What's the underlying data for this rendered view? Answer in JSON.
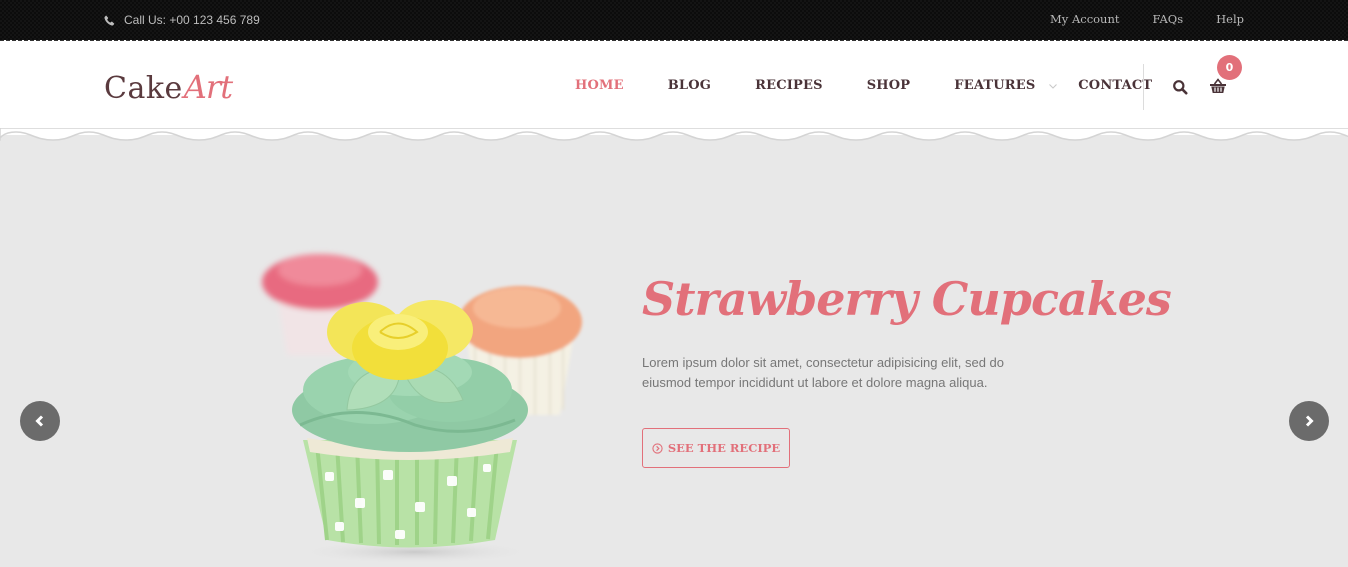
{
  "topbar": {
    "phone_icon": "phone-icon",
    "phone_text": "Call Us: +00 123 456 789",
    "links": [
      "My Account",
      "FAQs",
      "Help"
    ]
  },
  "header": {
    "logo": {
      "part1": "Cake",
      "part2": "Art"
    },
    "nav": [
      {
        "label": "HOME",
        "active": true
      },
      {
        "label": "BLOG",
        "active": false
      },
      {
        "label": "RECIPES",
        "active": false
      },
      {
        "label": "SHOP",
        "active": false
      },
      {
        "label": "FEATURES",
        "active": false,
        "has_dropdown": true
      },
      {
        "label": "CONTACT",
        "active": false
      }
    ],
    "search_icon": "search-icon",
    "cart_icon": "basket-icon",
    "cart_count": "0"
  },
  "hero": {
    "title": "Strawberry Cupcakes",
    "text_line1": "Lorem ipsum dolor sit amet, consectetur adipisicing elit, sed do",
    "text_line2": "eiusmod tempor incididunt ut labore et dolore magna aliqua.",
    "button_label": "SEE THE RECIPE",
    "button_icon": "circle-chevron-right-icon",
    "prev_icon": "chevron-left-icon",
    "next_icon": "chevron-right-icon"
  },
  "colors": {
    "accent": "#e2707a",
    "text_dark": "#4a3338",
    "hero_bg": "#e8e8e8",
    "arrow_bg": "#6b6b6b"
  }
}
